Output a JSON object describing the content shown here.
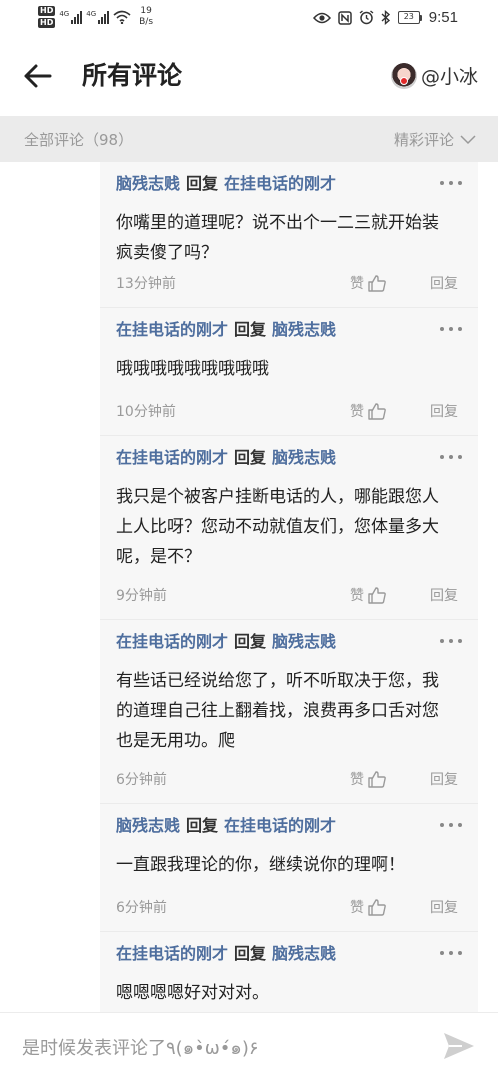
{
  "status_bar": {
    "network_1": "4G",
    "network_2": "4G",
    "speed_value": "19",
    "speed_unit": "B/s",
    "battery": "23",
    "time": "9:51"
  },
  "header": {
    "title": "所有评论",
    "username": "@小冰"
  },
  "filter": {
    "all_label": "全部评论（98）",
    "sort_label": "精彩评论"
  },
  "comments": [
    {
      "author": "脑残志贱",
      "relation": "回复",
      "target": "在挂电话的刚才",
      "text": "你嘴里的道理呢？说不出个一二三就开始装疯卖傻了吗？",
      "time": "13分钟前",
      "like": "赞",
      "reply": "回复"
    },
    {
      "author": "在挂电话的刚才",
      "relation": "回复",
      "target": "脑残志贱",
      "text": "哦哦哦哦哦哦哦哦哦",
      "time": "10分钟前",
      "like": "赞",
      "reply": "回复"
    },
    {
      "author": "在挂电话的刚才",
      "relation": "回复",
      "target": "脑残志贱",
      "text": "我只是个被客户挂断电话的人，哪能跟您人上人比呀？您动不动就值友们，您体量多大呢，是不？",
      "time": "9分钟前",
      "like": "赞",
      "reply": "回复"
    },
    {
      "author": "在挂电话的刚才",
      "relation": "回复",
      "target": "脑残志贱",
      "text": "有些话已经说给您了，听不听取决于您，我的道理自己往上翻着找，浪费再多口舌对您也是无用功。爬",
      "time": "6分钟前",
      "like": "赞",
      "reply": "回复"
    },
    {
      "author": "脑残志贱",
      "relation": "回复",
      "target": "在挂电话的刚才",
      "text": "一直跟我理论的你，继续说你的理啊！",
      "time": "6分钟前",
      "like": "赞",
      "reply": "回复"
    },
    {
      "author": "在挂电话的刚才",
      "relation": "回复",
      "target": "脑残志贱",
      "text": "嗯嗯嗯嗯好对对对。",
      "time": "",
      "like": "",
      "reply": ""
    }
  ],
  "input": {
    "placeholder": "是时候发表评论了٩(๑•̀ω•́๑)۶"
  },
  "colors": {
    "username_blue": "#4e6e9e",
    "filter_bg": "#ebebeb",
    "list_bg": "#f7f7f7"
  },
  "icons": [
    "back-arrow-icon",
    "avatar",
    "chevron-down-icon",
    "more-dots-icon",
    "thumbs-up-icon",
    "send-icon",
    "eye-icon",
    "nfc-icon",
    "alarm-icon",
    "bluetooth-icon",
    "wifi-icon",
    "signal-icon",
    "battery-icon"
  ]
}
